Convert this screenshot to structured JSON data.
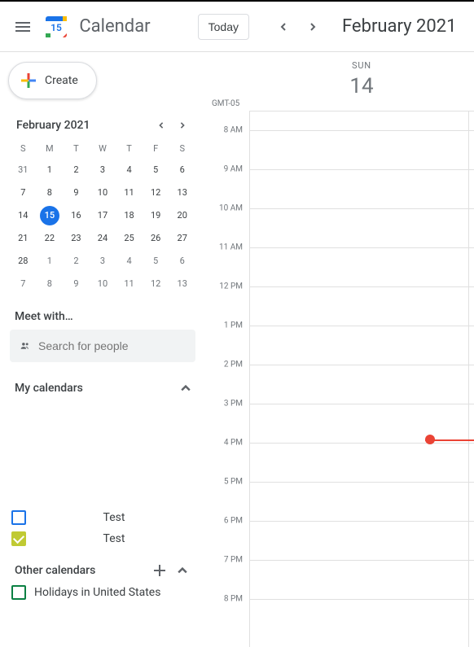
{
  "header": {
    "app_title": "Calendar",
    "logo_day": "15",
    "today_label": "Today",
    "date_label": "February 2021"
  },
  "create": {
    "label": "Create"
  },
  "mini_cal": {
    "title": "February 2021",
    "dow": [
      "S",
      "M",
      "T",
      "W",
      "T",
      "F",
      "S"
    ],
    "rows": [
      [
        {
          "n": "31",
          "o": true
        },
        {
          "n": "1"
        },
        {
          "n": "2"
        },
        {
          "n": "3"
        },
        {
          "n": "4"
        },
        {
          "n": "5"
        },
        {
          "n": "6"
        }
      ],
      [
        {
          "n": "7"
        },
        {
          "n": "8"
        },
        {
          "n": "9"
        },
        {
          "n": "10"
        },
        {
          "n": "11"
        },
        {
          "n": "12"
        },
        {
          "n": "13"
        }
      ],
      [
        {
          "n": "14"
        },
        {
          "n": "15",
          "sel": true
        },
        {
          "n": "16"
        },
        {
          "n": "17"
        },
        {
          "n": "18"
        },
        {
          "n": "19"
        },
        {
          "n": "20"
        }
      ],
      [
        {
          "n": "21"
        },
        {
          "n": "22"
        },
        {
          "n": "23"
        },
        {
          "n": "24"
        },
        {
          "n": "25"
        },
        {
          "n": "26"
        },
        {
          "n": "27"
        }
      ],
      [
        {
          "n": "28"
        },
        {
          "n": "1",
          "o": true
        },
        {
          "n": "2",
          "o": true
        },
        {
          "n": "3",
          "o": true
        },
        {
          "n": "4",
          "o": true
        },
        {
          "n": "5",
          "o": true
        },
        {
          "n": "6",
          "o": true
        }
      ],
      [
        {
          "n": "7",
          "o": true
        },
        {
          "n": "8",
          "o": true
        },
        {
          "n": "9",
          "o": true
        },
        {
          "n": "10",
          "o": true
        },
        {
          "n": "11",
          "o": true
        },
        {
          "n": "12",
          "o": true
        },
        {
          "n": "13",
          "o": true
        }
      ]
    ]
  },
  "meet": {
    "title": "Meet with…",
    "search_placeholder": "Search for people"
  },
  "my_calendars": {
    "title": "My calendars",
    "items": [
      {
        "label": "Test",
        "color": "#1a73e8",
        "checked": false
      },
      {
        "label": "Test",
        "color": "#c0ca33",
        "checked": true
      }
    ]
  },
  "other_calendars": {
    "title": "Other calendars",
    "items": [
      {
        "label": "Holidays in United States",
        "color": "#0b8043",
        "checked": false
      }
    ]
  },
  "day_view": {
    "tz": "GMT-05",
    "dow": "SUN",
    "num": "14",
    "hour_height": 48,
    "hours": [
      "8 AM",
      "9 AM",
      "10 AM",
      "11 AM",
      "12 PM",
      "1 PM",
      "2 PM",
      "3 PM",
      "4 PM",
      "5 PM",
      "6 PM",
      "7 PM",
      "8 PM"
    ],
    "now_hour_index": 8
  }
}
